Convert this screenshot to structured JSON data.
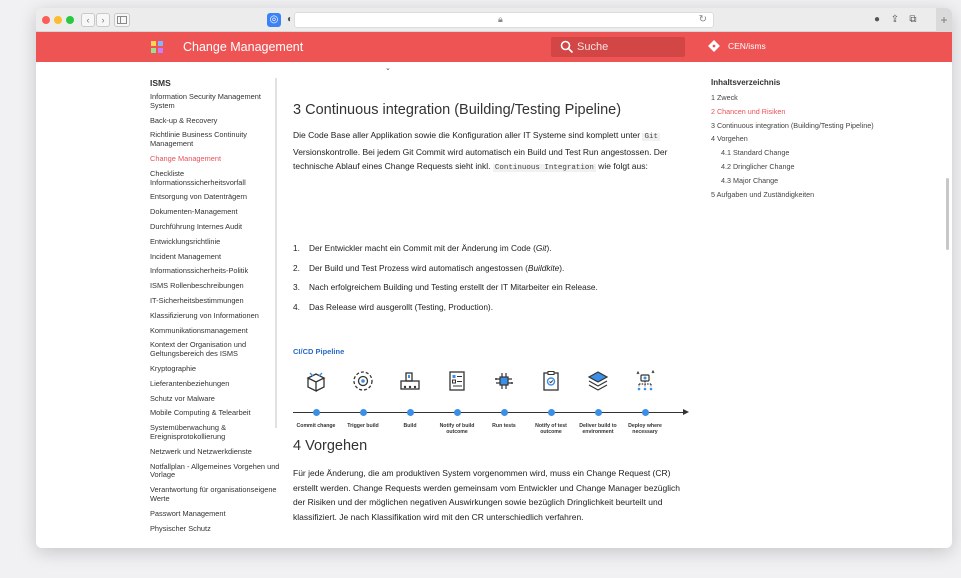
{
  "browser": {
    "traffic_colors": [
      "#fd5e57",
      "#fcbc2f",
      "#2ac840"
    ],
    "back_label": "‹",
    "forward_label": "›"
  },
  "app": {
    "title": "Change Management",
    "accent": "#ef5454",
    "search_placeholder": "Suche",
    "repo_label": "CEN/isms"
  },
  "sidebar": {
    "title": "ISMS",
    "items": [
      {
        "label": "Information Security Management System",
        "active": false
      },
      {
        "label": "Back-up & Recovery",
        "active": false
      },
      {
        "label": "Richtlinie Business Continuity Management",
        "active": false
      },
      {
        "label": "Change Management",
        "active": true
      },
      {
        "label": "Checkliste Informationssicherheitsvorfall",
        "active": false
      },
      {
        "label": "Entsorgung von Datenträgern",
        "active": false
      },
      {
        "label": "Dokumenten-Management",
        "active": false
      },
      {
        "label": "Durchführung Internes Audit",
        "active": false
      },
      {
        "label": "Entwicklungsrichtlinie",
        "active": false
      },
      {
        "label": "Incident Management",
        "active": false
      },
      {
        "label": "Informationssicherheits-Politik",
        "active": false
      },
      {
        "label": "ISMS Rollenbeschreibungen",
        "active": false
      },
      {
        "label": "IT-Sicherheitsbestimmungen",
        "active": false
      },
      {
        "label": "Klassifizierung von Informationen",
        "active": false
      },
      {
        "label": "Kommunikationsmanagement",
        "active": false
      },
      {
        "label": "Kontext der Organisation und Geltungsbereich des ISMS",
        "active": false
      },
      {
        "label": "Kryptographie",
        "active": false
      },
      {
        "label": "Lieferantenbeziehungen",
        "active": false
      },
      {
        "label": "Schutz vor Malware",
        "active": false
      },
      {
        "label": "Mobile Computing & Telearbeit",
        "active": false
      },
      {
        "label": "Systemüberwachung & Ereignisprotokollierung",
        "active": false
      },
      {
        "label": "Netzwerk und Netzwerkdienste",
        "active": false
      },
      {
        "label": "Notfallplan - Allgemeines Vorgehen und Vorlage",
        "active": false
      },
      {
        "label": "Verantwortung für organisationseigene Werte",
        "active": false
      },
      {
        "label": "Passwort Management",
        "active": false
      },
      {
        "label": "Physischer Schutz",
        "active": false
      }
    ]
  },
  "main": {
    "section3": {
      "heading": "3 Continuous integration (Building/Testing Pipeline)",
      "intro": {
        "t1": "Die Code Base aller Applikation sowie die Konfiguration aller IT Systeme sind komplett unter ",
        "code1": "Git",
        "t2": " Versionskontrolle. Bei jedem Git Commit wird automatisch ein Build und Test Run angestossen. Der technische Ablauf eines Change Requests sieht inkl. ",
        "code2": "Continuous Integration",
        "t3": " wie folgt aus:"
      },
      "steps": [
        {
          "num": "1.",
          "text": "Der Entwickler macht ein Commit mit der Änderung im Code (",
          "em": "Git",
          "tail": ")."
        },
        {
          "num": "2.",
          "text": "Der Build und Test Prozess wird automatisch angestossen (",
          "em": "Buildkite",
          "tail": ")."
        },
        {
          "num": "3.",
          "text": "Nach erfolgreichem Building und Testing erstellt der IT Mitarbeiter ein Release.",
          "em": "",
          "tail": ""
        },
        {
          "num": "4.",
          "text": "Das Release wird ausgerollt (Testing, Production).",
          "em": "",
          "tail": ""
        }
      ],
      "pipeline_title": "CI/CD Pipeline",
      "pipeline_stages": [
        {
          "icon": "box-icon",
          "label": "Commit change"
        },
        {
          "icon": "gear-target-icon",
          "label": "Trigger build"
        },
        {
          "icon": "factory-icon",
          "label": "Build"
        },
        {
          "icon": "checklist-icon",
          "label": "Notify of build outcome"
        },
        {
          "icon": "circuit-icon",
          "label": "Run tests"
        },
        {
          "icon": "clipboard-icon",
          "label": "Notify of test outcome"
        },
        {
          "icon": "layers-icon",
          "label": "Deliver build to environment"
        },
        {
          "icon": "deploy-icon",
          "label": "Deploy where necessary"
        }
      ]
    },
    "section4": {
      "heading": "4 Vorgehen",
      "text": "Für jede Änderung, die am produktiven System vorgenommen wird, muss ein Change Request (CR) erstellt werden. Change Requests werden gemeinsam vom Entwickler und Change Manager bezüglich der Risiken und der möglichen negativen Auswirkungen sowie bezüglich Dringlichkeit beurteilt und klassifiziert. Je nach Klassifikation wird mit den CR unterschiedlich verfahren."
    }
  },
  "toc": {
    "title": "Inhaltsverzeichnis",
    "items": [
      {
        "label": "1 Zweck",
        "active": false,
        "sub": false
      },
      {
        "label": "2 Chancen und Risiken",
        "active": true,
        "sub": false
      },
      {
        "label": "3 Continuous integration (Building/Testing Pipeline)",
        "active": false,
        "sub": false
      },
      {
        "label": "4 Vorgehen",
        "active": false,
        "sub": false
      },
      {
        "label": "4.1 Standard Change",
        "active": false,
        "sub": true
      },
      {
        "label": "4.2 Dringlicher Change",
        "active": false,
        "sub": true
      },
      {
        "label": "4.3 Major Change",
        "active": false,
        "sub": true
      },
      {
        "label": "5 Aufgaben und Zuständigkeiten",
        "active": false,
        "sub": false
      }
    ]
  }
}
